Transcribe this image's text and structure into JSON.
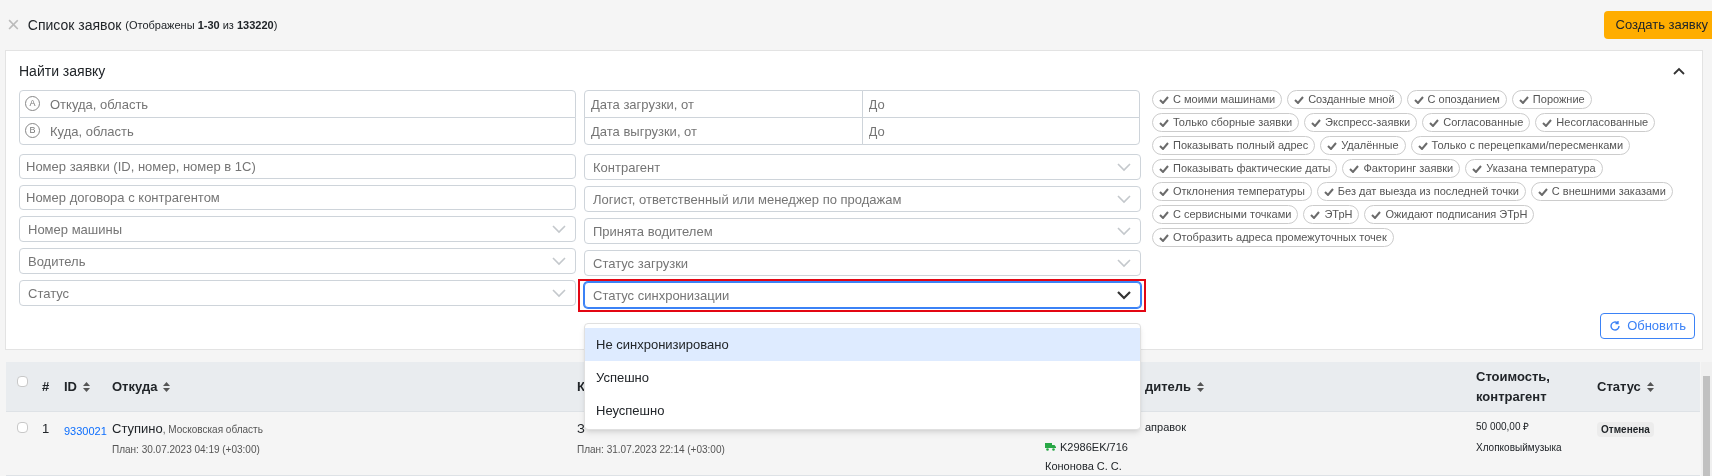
{
  "header": {
    "close_icon": "×",
    "title": "Список заявок",
    "subtitle": "(Отображены **1-30** из **133220**)",
    "create_button": "Создать заявку"
  },
  "search_panel": {
    "title": "Найти заявку",
    "expanded": true,
    "left_fields": [
      {
        "kind": "route",
        "items": [
          {
            "marker": "A",
            "placeholder": "Откуда, область"
          },
          {
            "marker": "B",
            "placeholder": "Куда, область"
          }
        ]
      },
      {
        "kind": "text",
        "placeholder": "Номер заявки (ID, номер, номер в 1С)"
      },
      {
        "kind": "text",
        "placeholder": "Номер договора с контрагентом"
      },
      {
        "kind": "select",
        "placeholder": "Номер машины",
        "focused": false,
        "highlighted": false
      },
      {
        "kind": "select",
        "placeholder": "Водитель",
        "focused": false,
        "highlighted": false
      },
      {
        "kind": "select",
        "placeholder": "Статус",
        "focused": false,
        "highlighted": false
      }
    ],
    "middle_fields": [
      {
        "kind": "date_range",
        "rows": [
          {
            "fields": [
              {
                "placeholder": "Дата загрузки, от"
              },
              {
                "placeholder": "До"
              }
            ]
          },
          {
            "fields": [
              {
                "placeholder": "Дата выгрузки, от"
              },
              {
                "placeholder": "До"
              }
            ]
          }
        ]
      },
      {
        "kind": "select",
        "placeholder": "Контрагент",
        "focused": false,
        "highlighted": false
      },
      {
        "kind": "select",
        "placeholder": "Логист, ответственный или менеджер по продажам",
        "focused": false,
        "highlighted": false
      },
      {
        "kind": "select",
        "placeholder": "Принята водителем",
        "focused": false,
        "highlighted": false
      },
      {
        "kind": "select",
        "placeholder": "Статус загрузки",
        "focused": false,
        "highlighted": false
      },
      {
        "kind": "select",
        "placeholder": "Статус синхронизации",
        "focused": true,
        "highlighted": true
      }
    ],
    "filter_chip_rows": [
      [
        "С моими машинами",
        "Созданные мной",
        "С опозданием",
        "Порожние"
      ],
      [
        "Только сборные заявки",
        "Экспресс-заявки",
        "Согласованные",
        "Несогласованные"
      ],
      [
        "Показывать полный адрес",
        "Удалённые",
        "Только с перецепками/пересменками"
      ],
      [
        "Показывать фактические даты",
        "Факторинг заявки",
        "Указана температура"
      ],
      [
        "Отклонения температуры",
        "Без дат выезда из последней точки",
        "С внешними заказами"
      ],
      [
        "С сервисными точками",
        "ЭТрН",
        "Ожидают подписания ЭТрН"
      ],
      [
        "Отобразить адреса промежуточных точек"
      ]
    ],
    "refresh_button": "Обновить"
  },
  "dropdown": {
    "options": [
      {
        "label": "Не синхронизировано",
        "selected": true
      },
      {
        "label": "Успешно",
        "selected": false
      },
      {
        "label": "Неуспешно",
        "selected": false
      }
    ]
  },
  "table": {
    "header_checkbox": {
      "checked": false
    },
    "columns": [
      {
        "label": "#",
        "sortable": false
      },
      {
        "label": "ID",
        "sortable": true
      },
      {
        "label": "Откуда",
        "sortable": true
      },
      {
        "label": "К",
        "sortable": false
      },
      {
        "label": "дитель",
        "sortable": true
      },
      {
        "label": "Стоимость, контрагент",
        "sortable": false
      },
      {
        "label": "Статус",
        "sortable": true
      }
    ],
    "rows": [
      {
        "checked": false,
        "number": "1",
        "id": "9330021",
        "from_city": "Ступино",
        "from_region": ", Московская область",
        "from_plan": "План: 30.07.2023 04:19 (+03:00)",
        "to_city": "З",
        "to_plan": "План: 31.07.2023 22:14 (+03:00)",
        "driver_note": "аправок",
        "plate": "K2986EK/716",
        "driver_name": "Кононова С. С.",
        "cost": "50 000,00 ₽",
        "contractor": "Хлопковыймузыка",
        "status": "Отменена"
      }
    ]
  }
}
